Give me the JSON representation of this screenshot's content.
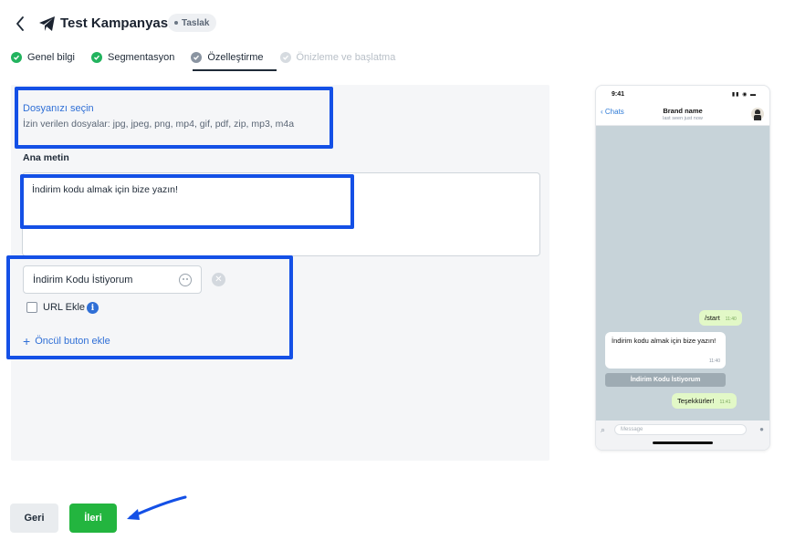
{
  "header": {
    "title": "Test Kampanyası",
    "badge": "Taslak"
  },
  "steps": [
    {
      "label": "Genel bilgi",
      "state": "done"
    },
    {
      "label": "Segmentasyon",
      "state": "done"
    },
    {
      "label": "Özelleştirme",
      "state": "active"
    },
    {
      "label": "Önizleme ve başlatma",
      "state": "todo"
    }
  ],
  "upload": {
    "link": "Dosyanızı seçin",
    "hint": "İzin verilen dosyalar: jpg, jpeg, png, mp4, gif, pdf, zip, mp3, m4a"
  },
  "main_text": {
    "label": "Ana metin",
    "value": "İndirim kodu almak için bize yazın!"
  },
  "quick_button": {
    "value": "İndirim Kodu İstiyorum",
    "url_label": "URL Ekle",
    "add_label": "Öncül buton ekle"
  },
  "footer": {
    "back_label": "Geri",
    "next_label": "İleri"
  },
  "preview": {
    "time": "9:41",
    "back": "Chats",
    "name": "Brand name",
    "seen": "last seen just now",
    "messages": [
      {
        "dir": "out",
        "text": "/start",
        "time": "11:40"
      },
      {
        "dir": "in",
        "text": "İndirim kodu almak için bize yazın!",
        "time": "11:40"
      },
      {
        "dir": "out",
        "text": "Teşekkürler!",
        "time": "11:41"
      }
    ],
    "inline_button": "İndirim Kodu İstiyorum",
    "input_placeholder": "Message"
  },
  "colors": {
    "accent": "#2f6fd6",
    "success": "#23b53f",
    "highlight": "#1450e6"
  }
}
